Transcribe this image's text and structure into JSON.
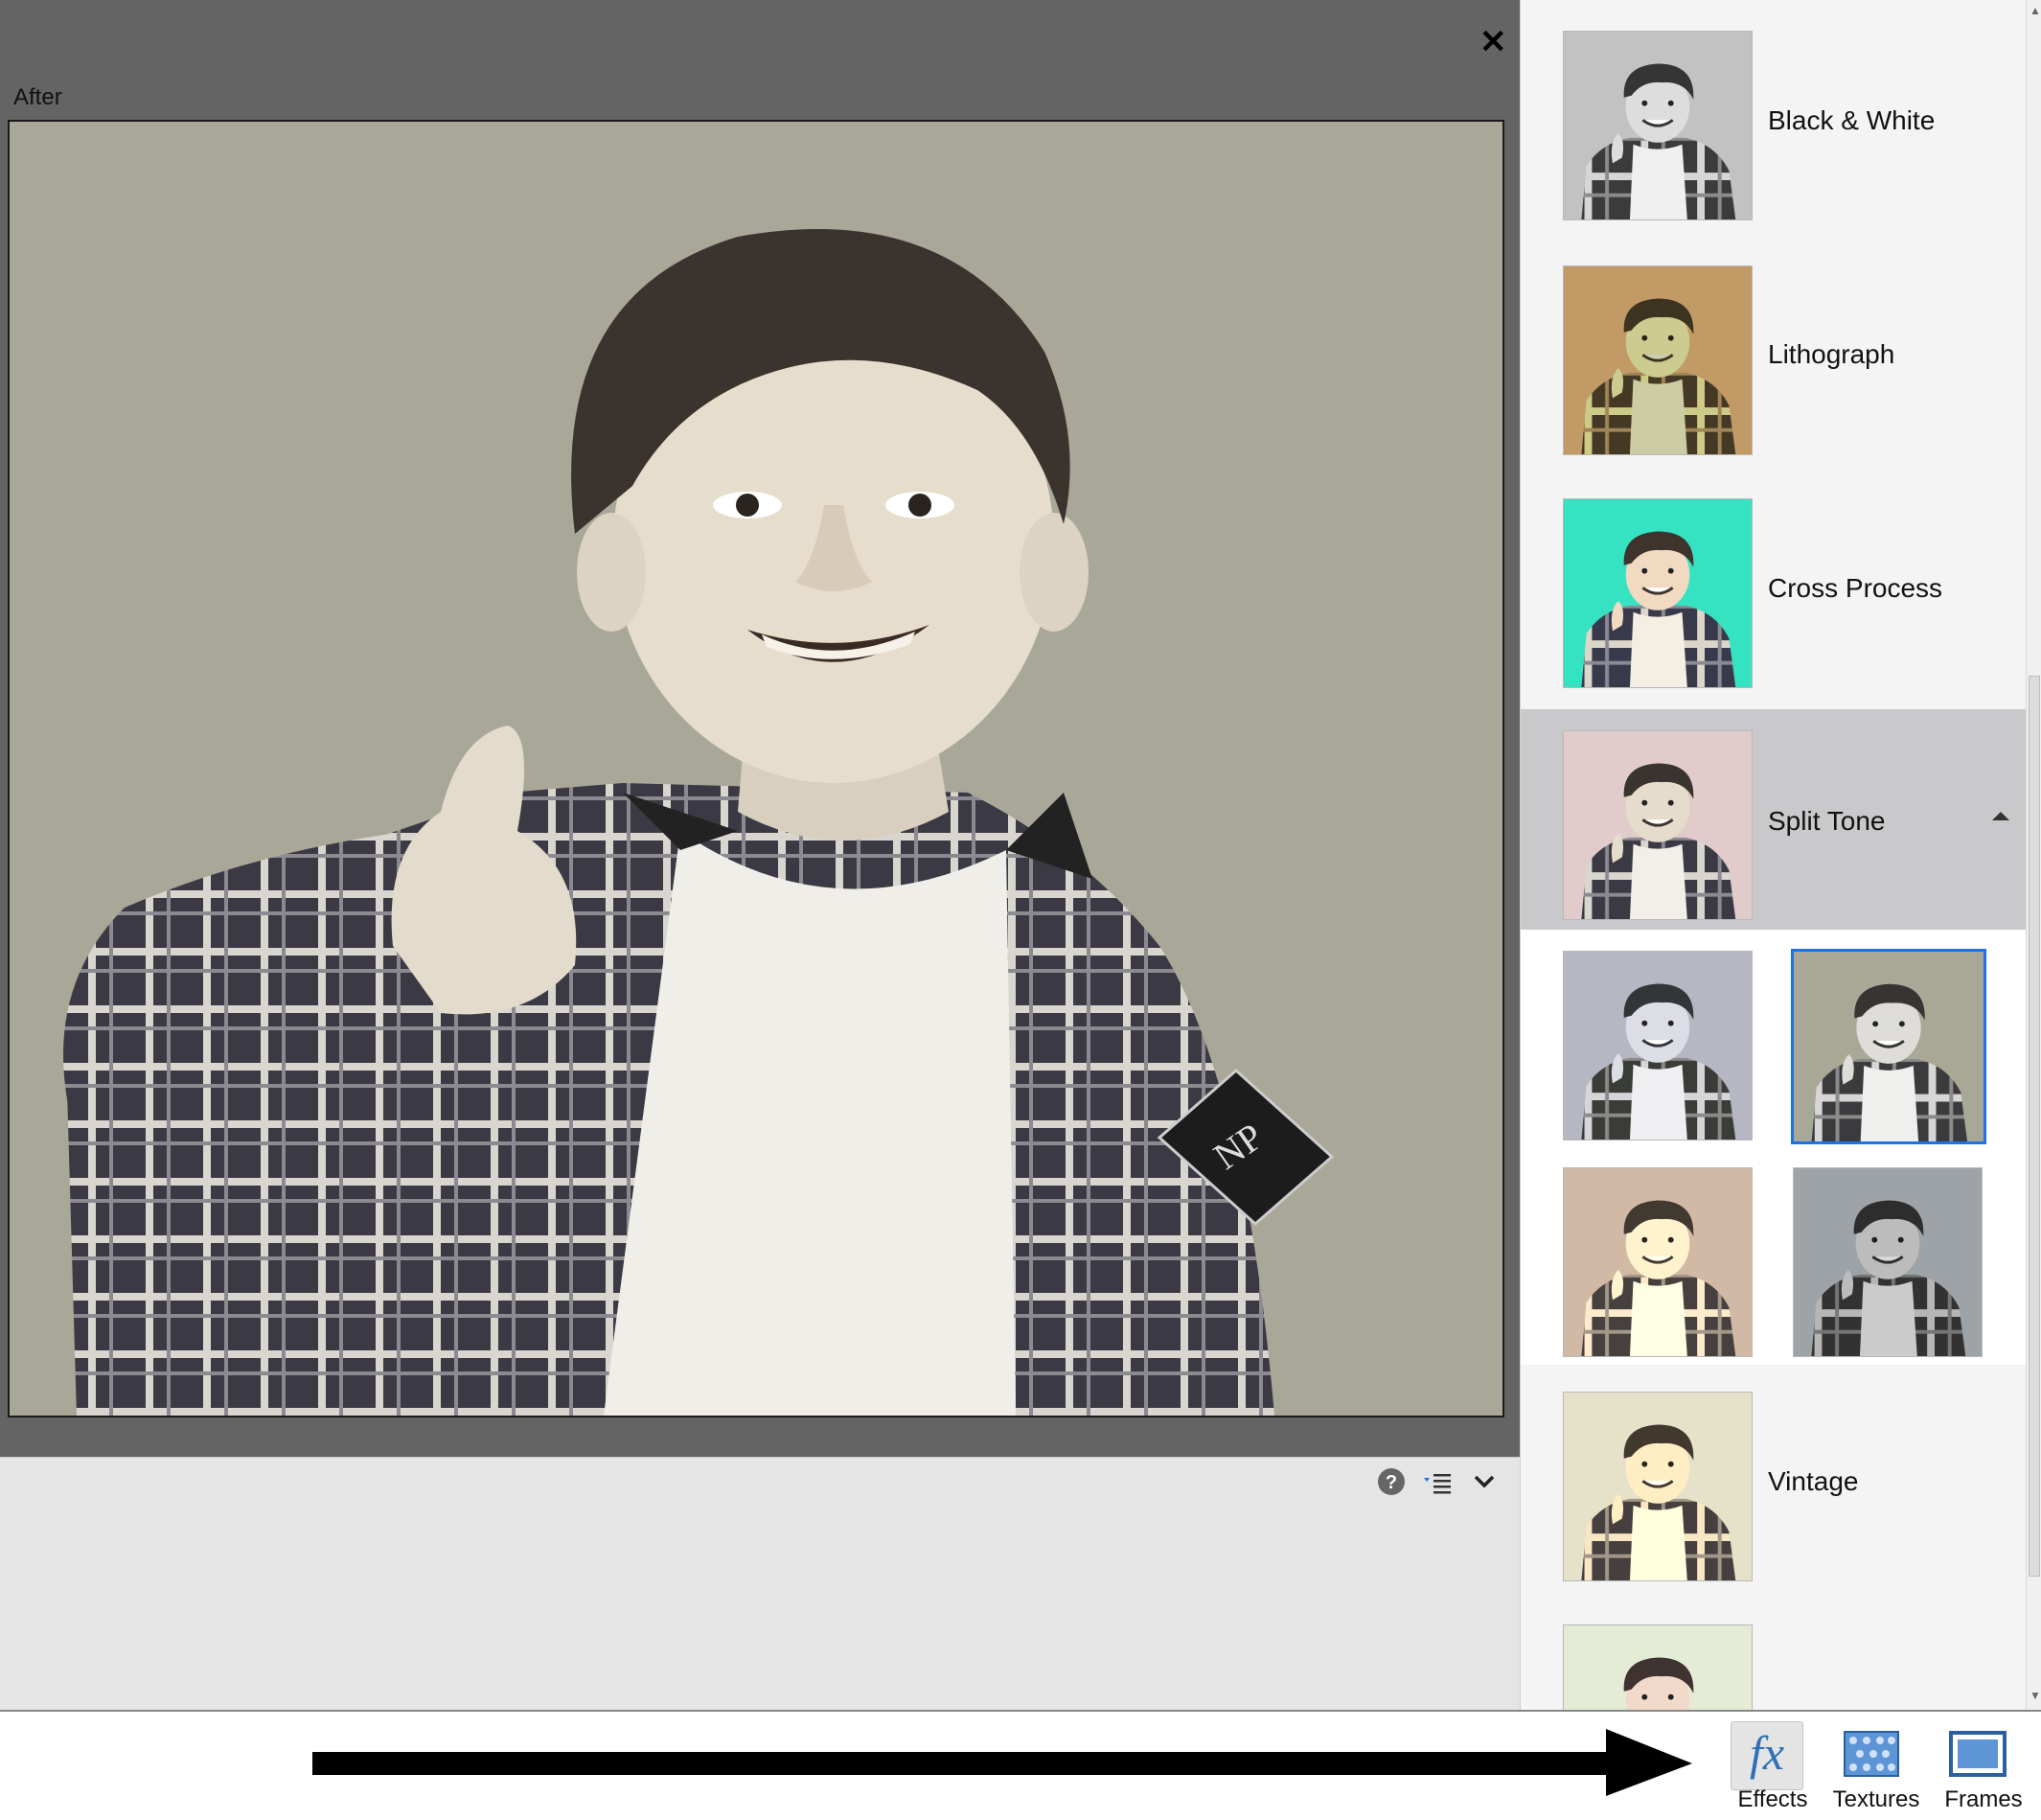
{
  "preview": {
    "view_label": "After",
    "close_icon": "close-icon"
  },
  "toolbar": {
    "help_icon": "help-icon",
    "list_options_icon": "list-options-icon",
    "expand_icon": "chevron-down-icon"
  },
  "effects": {
    "items": [
      {
        "label": "Black & White"
      },
      {
        "label": "Lithograph"
      },
      {
        "label": "Cross Process"
      },
      {
        "label": "Split Tone",
        "selected": true
      },
      {
        "label": "Vintage"
      }
    ],
    "expanded": "Split Tone",
    "variants_count": 4,
    "active_variant": 2
  },
  "bottom_tabs": [
    {
      "label": "Effects",
      "active": true
    },
    {
      "label": "Textures"
    },
    {
      "label": "Frames"
    }
  ],
  "colors": {
    "accent": "#1a73e8",
    "preview_bg": "#646464",
    "panel_bg": "#f4f4f4",
    "selected_row": "#c9c9cc"
  }
}
